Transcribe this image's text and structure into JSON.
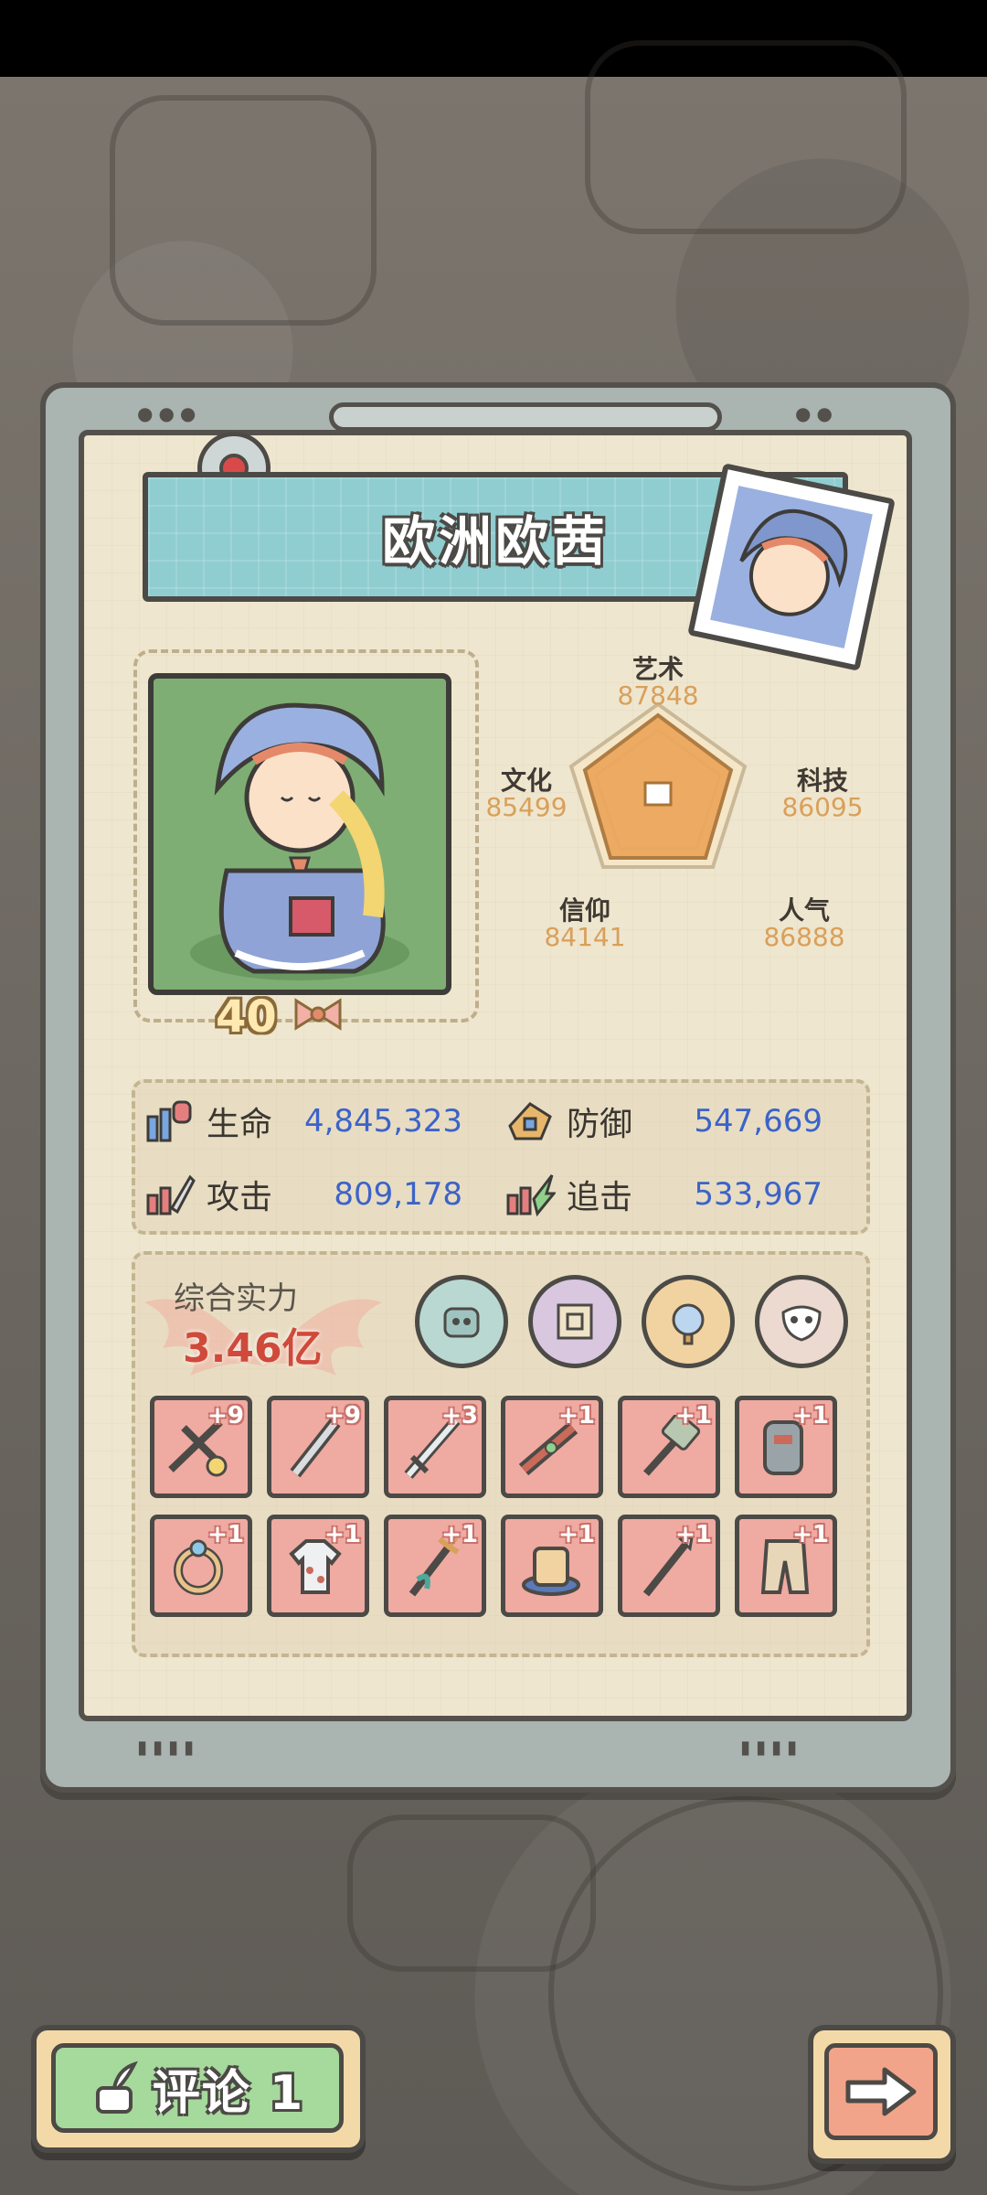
{
  "character": {
    "name": "欧洲欧茜",
    "level": "40"
  },
  "attributes": [
    {
      "label": "艺术",
      "value": "87848"
    },
    {
      "label": "科技",
      "value": "86095"
    },
    {
      "label": "人气",
      "value": "86888"
    },
    {
      "label": "信仰",
      "value": "84141"
    },
    {
      "label": "文化",
      "value": "85499"
    }
  ],
  "stats": [
    {
      "label": "生命",
      "value": "4,845,323",
      "icon": "health-icon"
    },
    {
      "label": "防御",
      "value": "547,669",
      "icon": "defense-icon"
    },
    {
      "label": "攻击",
      "value": "809,178",
      "icon": "attack-icon"
    },
    {
      "label": "追击",
      "value": "533,967",
      "icon": "pursuit-icon"
    }
  ],
  "power": {
    "label": "综合实力",
    "value": "3.46亿"
  },
  "partners": [
    "robot-partner-icon",
    "map-partner-icon",
    "mirror-partner-icon",
    "mask-partner-icon"
  ],
  "equipment": [
    {
      "level": "+9",
      "icon": "crossbow-icon"
    },
    {
      "level": "+9",
      "icon": "dagger-icon"
    },
    {
      "level": "+3",
      "icon": "sword-icon"
    },
    {
      "level": "+1",
      "icon": "gun-icon"
    },
    {
      "level": "+1",
      "icon": "hammer-icon"
    },
    {
      "level": "+1",
      "icon": "armor-icon"
    },
    {
      "level": "+1",
      "icon": "ring-icon"
    },
    {
      "level": "+1",
      "icon": "shirt-icon"
    },
    {
      "level": "+1",
      "icon": "trident-icon"
    },
    {
      "level": "+1",
      "icon": "hat-icon"
    },
    {
      "level": "+1",
      "icon": "spear-icon"
    },
    {
      "level": "+1",
      "icon": "pants-icon"
    }
  ],
  "buttons": {
    "comment_label": "评论 1",
    "next_icon": "arrow-right-icon"
  },
  "colors": {
    "panel": "#efe6cf",
    "title_bar": "#8fcdd0",
    "stat_value": "#3c63c8",
    "attr_value": "#d9a05a",
    "power_value": "#cf4a3a",
    "equip_bg": "#efaaa2"
  }
}
